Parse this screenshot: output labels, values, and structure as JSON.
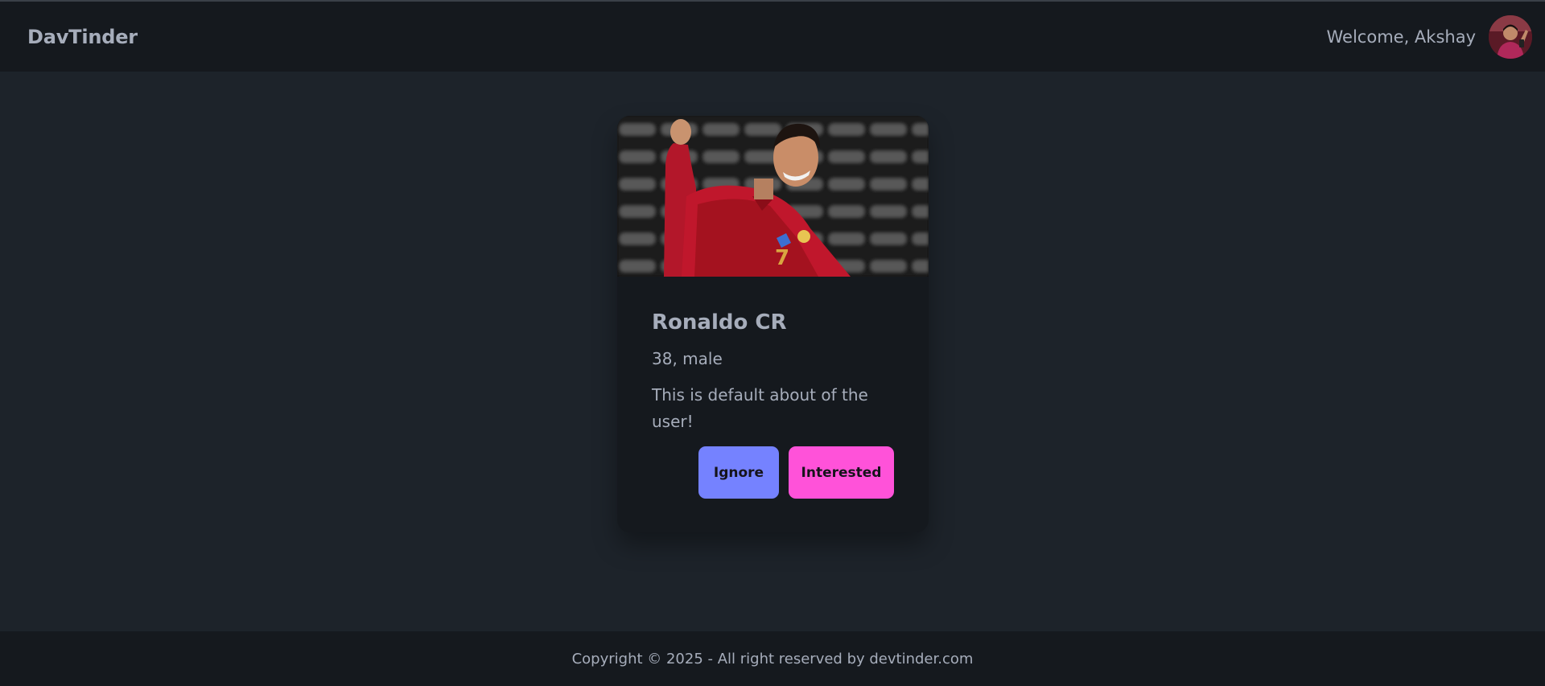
{
  "navbar": {
    "brand": "DavTinder",
    "welcome_text": "Welcome, Akshay",
    "avatar_alt": "user avatar"
  },
  "feed": {
    "card": {
      "name": "Ronaldo CR",
      "age_gender": "38, male",
      "about": "This is default about of the user!",
      "photo_alt": "profile photo"
    },
    "actions": {
      "ignore_label": "Ignore",
      "interested_label": "Interested"
    }
  },
  "footer": {
    "copyright": "Copyright © 2025 - All right reserved by devtinder.com"
  },
  "colors": {
    "background": "#1d232a",
    "surface": "#15191e",
    "text": "#a6adbb",
    "primary": "#7582ff",
    "secondary": "#ff52d9"
  }
}
